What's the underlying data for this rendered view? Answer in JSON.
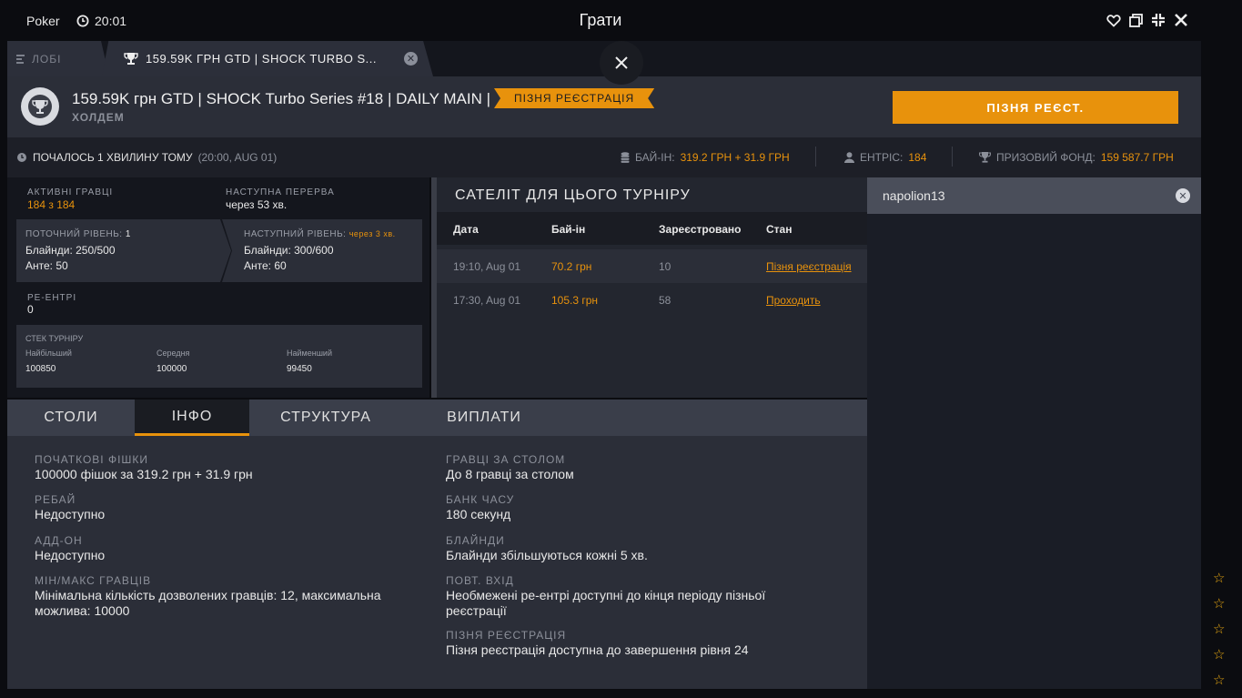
{
  "titlebar": {
    "app": "Poker",
    "time": "20:01",
    "title": "Грати"
  },
  "tabs_bar": {
    "lobby": "ЛОБІ",
    "active": "159.59K ГРН GTD | SHOCK TURBO S..."
  },
  "header": {
    "name": "159.59K грн GTD | SHOCK Turbo Series #18 | DAILY MAIN |",
    "game": "ХОЛДЕМ",
    "late_badge": "ПІЗНЯ РЕЄСТРАЦІЯ",
    "late_button": "ПІЗНЯ РЕЄСТ."
  },
  "infobar": {
    "started": "ПОЧАЛОСЬ 1 ХВИЛИНУ ТОМУ",
    "started_time": "(20:00, AUG 01)",
    "buyin_label": "БАЙ-ІН:",
    "buyin": "319.2 ГРН + 31.9 ГРН",
    "entries_label": "ЕНТРІС:",
    "entries": "184",
    "prize_label": "ПРИЗОВИЙ ФОНД:",
    "prize": "159 587.7 ГРН"
  },
  "stats": {
    "active_label": "АКТИВНІ ГРАВЦІ",
    "active": "184 з 184",
    "break_label": "НАСТУПНА ПЕРЕРВА",
    "break": "через 53 хв.",
    "cur_label": "ПОТОЧНИЙ РІВЕНЬ:",
    "cur_level": "1",
    "cur_blinds": "Блайнди: 250/500",
    "cur_ante": "Анте: 50",
    "next_label": "НАСТУПНИЙ РІВЕНЬ:",
    "next_in": "через 3 хв.",
    "next_blinds": "Блайнди: 300/600",
    "next_ante": "Анте: 60",
    "reentry_label": "РЕ-ЕНТРІ",
    "reentry": "0",
    "stack_label": "СТЕК ТУРНІРУ",
    "largest_label": "Найбільший",
    "largest": "100850",
    "average_label": "Середня",
    "average": "100000",
    "smallest_label": "Найменший",
    "smallest": "99450"
  },
  "satellite": {
    "title": "САТЕЛІТ ДЛЯ ЦЬОГО ТУРНІРУ",
    "headers": [
      "Дата",
      "Бай-ін",
      "Зареєстровано",
      "Стан"
    ],
    "rows": [
      {
        "date": "19:10, Aug 01",
        "buyin": "70.2 грн",
        "registered": "10",
        "status": "Пізня реєстрація"
      },
      {
        "date": "17:30, Aug 01",
        "buyin": "105.3 грн",
        "registered": "58",
        "status": "Проходить"
      }
    ]
  },
  "search": {
    "value": "napolion13"
  },
  "content_tabs": [
    "СТОЛИ",
    "ІНФО",
    "СТРУКТУРА",
    "ВИПЛАТИ"
  ],
  "info": {
    "left": [
      {
        "label": "ПОЧАТКОВІ ФІШКИ",
        "value": "100000 фішок за 319.2 грн + 31.9 грн"
      },
      {
        "label": "РЕБАЙ",
        "value": "Недоступно"
      },
      {
        "label": "АДД-ОН",
        "value": "Недоступно"
      },
      {
        "label": "МІН/МАКС ГРАВЦІВ",
        "value": "Мінімальна кількість дозволених гравців: 12, максимальна можлива: 10000"
      }
    ],
    "right": [
      {
        "label": "ГРАВЦІ ЗА СТОЛОМ",
        "value": "До 8 гравці за столом"
      },
      {
        "label": "БАНК ЧАСУ",
        "value": "180 секунд"
      },
      {
        "label": "БЛАЙНДИ",
        "value": "Блайнди збільшуються кожні 5 хв."
      },
      {
        "label": "ПОВТ. ВХІД",
        "value": "Необмежені ре-ентрі доступні до кінця періоду пізньої реєстрації"
      },
      {
        "label": "ПІЗНЯ РЕЄСТРАЦІЯ",
        "value": "Пізня реєстрація доступна до завершення рівня 24"
      }
    ]
  },
  "colors": {
    "accent": "#e8920c",
    "star": "#e8a812"
  }
}
